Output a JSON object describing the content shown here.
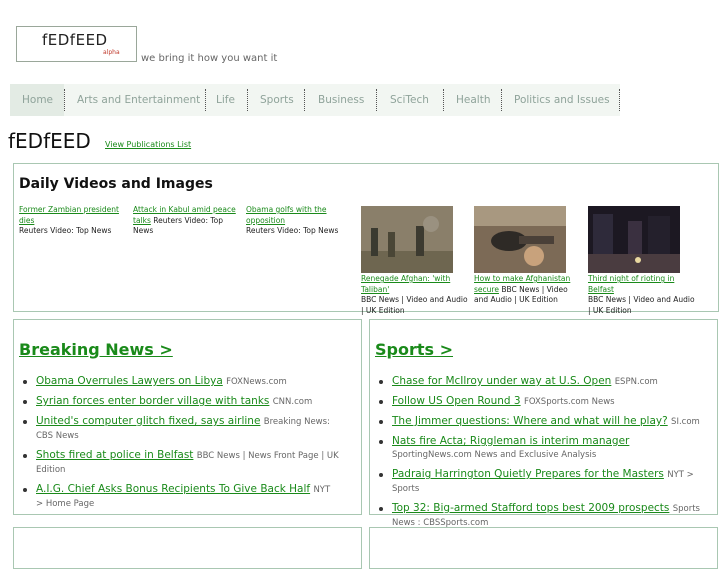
{
  "logo": {
    "text": "fEDfEED",
    "badge": "alpha",
    "tagline": "we bring it how you want it"
  },
  "nav": {
    "items": [
      "Home",
      "Arts and Entertainment",
      "Life",
      "Sports",
      "Business",
      "SciTech",
      "Health",
      "Politics and Issues"
    ]
  },
  "publication": {
    "title": "fEDfEED",
    "link": "View Publications List"
  },
  "videos": {
    "title": "Daily Videos and Images",
    "text_items": [
      {
        "link": "Former Zambian president dies",
        "source": "Reuters Video: Top News"
      },
      {
        "link": "Attack in Kabul amid peace talks",
        "source": "Reuters Video: Top News"
      },
      {
        "link": "Obama golfs with the opposition",
        "source": "Reuters Video: Top News"
      }
    ],
    "image_items": [
      {
        "link": "Renegade Afghan: 'with Taliban'",
        "source": "BBC News | Video and Audio | UK Edition"
      },
      {
        "link": "How to make Afghanistan secure",
        "source": "BBC News | Video and Audio | UK Edition"
      },
      {
        "link": "Third night of rioting in Belfast",
        "source": "BBC News | Video and Audio | UK Edition"
      }
    ]
  },
  "breaking": {
    "title": "Breaking News >",
    "items": [
      {
        "link": "Obama Overrules Lawyers on Libya",
        "source": "FOXNews.com"
      },
      {
        "link": "Syrian forces enter border village with tanks",
        "source": "CNN.com"
      },
      {
        "link": "United's computer glitch fixed, says airline",
        "source": "Breaking News: CBS News"
      },
      {
        "link": "Shots fired at police in Belfast",
        "source": "BBC News | News Front Page | UK Edition"
      },
      {
        "link": "A.I.G. Chief Asks Bonus Recipients To Give Back Half",
        "source": "NYT > Home Page"
      }
    ]
  },
  "sports": {
    "title": "Sports >",
    "items": [
      {
        "link": "Chase for McIlroy under way at U.S. Open",
        "source": "ESPN.com"
      },
      {
        "link": "Follow US Open Round 3",
        "source": "FOXSports.com News"
      },
      {
        "link": "The Jimmer questions: Where and what will he play?",
        "source": "SI.com"
      },
      {
        "link": "Nats fire Acta; Riggleman is interim manager",
        "source": "SportingNews.com News and Exclusive Analysis"
      },
      {
        "link": "Padraig Harrington Quietly Prepares for the Masters",
        "source": "NYT > Sports"
      },
      {
        "link": "Top 32: Big-armed Stafford tops best 2009 prospects",
        "source": "Sports News : CBSSports.com"
      }
    ]
  }
}
